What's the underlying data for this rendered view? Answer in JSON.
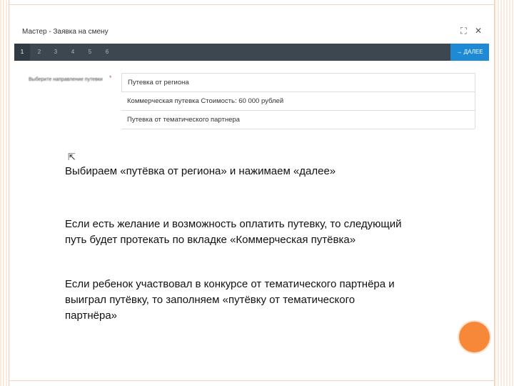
{
  "dialog": {
    "title": "Мастер - Заявка на смену",
    "icons": [
      "maximize-icon",
      "close-icon"
    ],
    "steps": [
      "1",
      "2",
      "3",
      "4",
      "5",
      "6"
    ],
    "active_step": "1",
    "next_label": "→ ДАЛЕЕ",
    "field_label": "Выберите направление путевки",
    "required_mark": "*",
    "options": [
      "Путевка от региона",
      "Коммерческая путевка Стоимость: 60 000 рублей",
      "Путевка от тематического партнера"
    ]
  },
  "slide": {
    "line1": "Выбираем «путёвка от региона» и нажимаем «далее»",
    "line2": "Если есть желание и возможность оплатить путевку, то следующий путь будет протекать по вкладке «Коммерческая путёвка»",
    "line3": "Если ребенок участвовал в конкурсе от тематического партнёра и выиграл путёвку, то заполняем «путёвку от тематического партнёра»"
  },
  "colors": {
    "wizard_bar": "#3c4750",
    "next_button": "#1e8ad6",
    "accent_dot": "#f7883a"
  }
}
